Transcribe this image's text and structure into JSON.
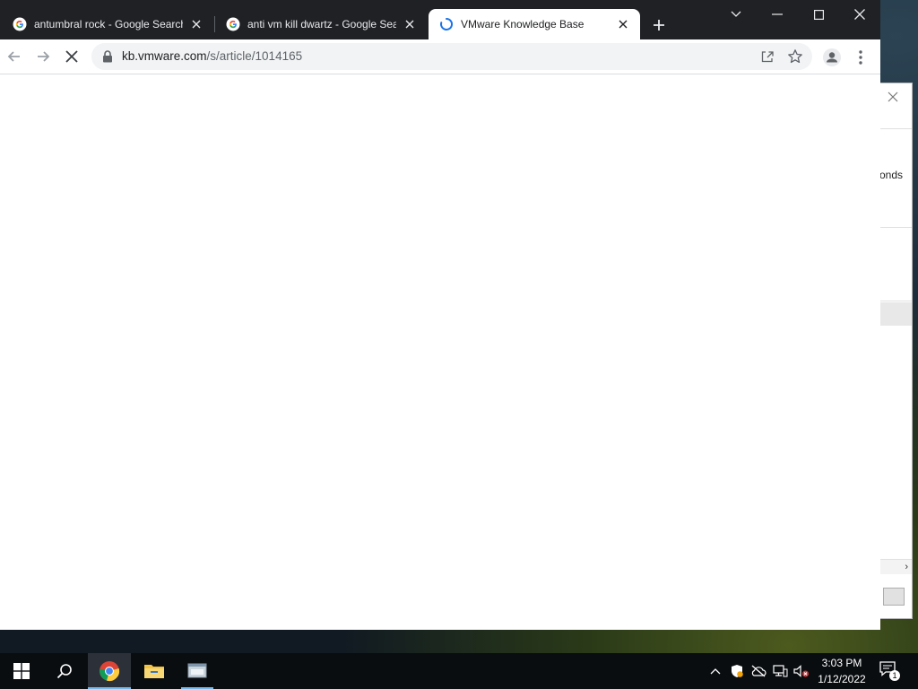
{
  "browser": {
    "tabs": [
      {
        "title": "antumbral rock - Google Search",
        "favicon": "google-icon",
        "active": false
      },
      {
        "title": "anti vm kill dwartz - Google Search",
        "favicon": "google-icon",
        "active": false
      },
      {
        "title": "VMware Knowledge Base",
        "favicon": "loading-spinner-icon",
        "active": true
      }
    ],
    "address": {
      "host": "kb.vmware.com",
      "path": "/s/article/1014165"
    },
    "accent_color": "#202124",
    "loading": true
  },
  "background_window": {
    "partial_text": "onds"
  },
  "taskbar": {
    "pinned": [
      {
        "name": "start",
        "icon": "windows-logo-icon"
      },
      {
        "name": "search",
        "icon": "search-icon"
      },
      {
        "name": "chrome",
        "icon": "chrome-icon",
        "running": true
      },
      {
        "name": "file-explorer",
        "icon": "folder-icon"
      },
      {
        "name": "app",
        "icon": "app-window-icon",
        "running": true
      }
    ],
    "clock": {
      "time": "3:03 PM",
      "date": "1/12/2022"
    },
    "notification_count": "1"
  }
}
